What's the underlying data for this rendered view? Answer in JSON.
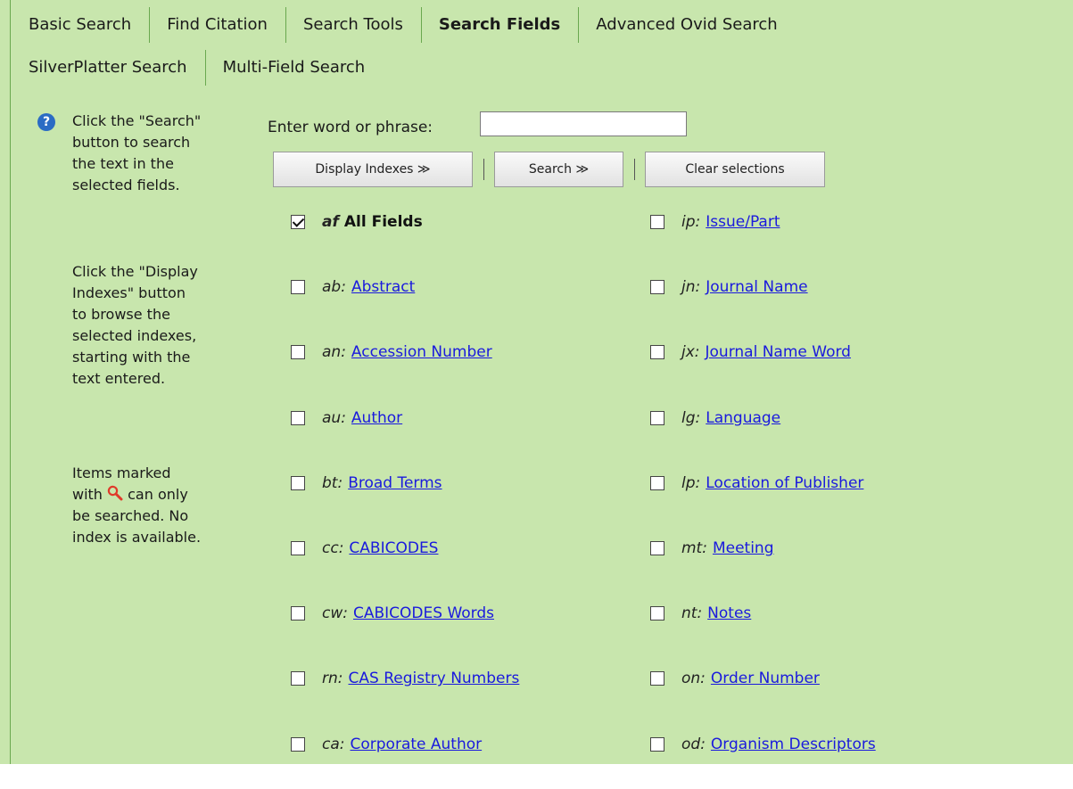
{
  "tabs_row1": [
    "Basic Search",
    "Find Citation",
    "Search Tools",
    "Search Fields",
    "Advanced Ovid Search"
  ],
  "tabs_row2": [
    "SilverPlatter Search",
    "Multi-Field Search"
  ],
  "active_tab": "Search Fields",
  "help": {
    "icon": "question-icon",
    "p1": "Click the \"Search\"\nbutton to search\nthe text in the\nselected fields.",
    "p2": "Click the \"Display\nIndexes\" button\nto browse the\nselected indexes,\nstarting with the\ntext entered.",
    "p3_before": "Items marked\nwith ",
    "p3_icon": "magnifier-icon",
    "p3_after": " can only\nbe searched. No\nindex is available."
  },
  "search": {
    "label": "Enter word or phrase:",
    "value": "",
    "display_indexes": "Display Indexes ≫",
    "search": "Search ≫",
    "clear": "Clear selections"
  },
  "fields_left": [
    {
      "code": "af",
      "name": "All Fields",
      "checked": true,
      "link": false
    },
    {
      "code": "ab:",
      "name": "Abstract",
      "checked": false,
      "link": true
    },
    {
      "code": "an:",
      "name": "Accession Number",
      "checked": false,
      "link": true
    },
    {
      "code": "au:",
      "name": "Author",
      "checked": false,
      "link": true
    },
    {
      "code": "bt:",
      "name": "Broad Terms",
      "checked": false,
      "link": true
    },
    {
      "code": "cc:",
      "name": "CABICODES",
      "checked": false,
      "link": true
    },
    {
      "code": "cw:",
      "name": "CABICODES Words",
      "checked": false,
      "link": true
    },
    {
      "code": "rn:",
      "name": "CAS Registry Numbers",
      "checked": false,
      "link": true
    },
    {
      "code": "ca:",
      "name": "Corporate Author",
      "checked": false,
      "link": true
    }
  ],
  "fields_right": [
    {
      "code": "ip:",
      "name": "Issue/Part",
      "checked": false,
      "link": true
    },
    {
      "code": "jn:",
      "name": "Journal Name",
      "checked": false,
      "link": true
    },
    {
      "code": "jx:",
      "name": "Journal Name Word",
      "checked": false,
      "link": true
    },
    {
      "code": "lg:",
      "name": "Language",
      "checked": false,
      "link": true
    },
    {
      "code": "lp:",
      "name": "Location of Publisher",
      "checked": false,
      "link": true
    },
    {
      "code": "mt:",
      "name": "Meeting",
      "checked": false,
      "link": true
    },
    {
      "code": "nt:",
      "name": "Notes",
      "checked": false,
      "link": true
    },
    {
      "code": "on:",
      "name": "Order Number",
      "checked": false,
      "link": true
    },
    {
      "code": "od:",
      "name": "Organism Descriptors",
      "checked": false,
      "link": true
    }
  ],
  "colors": {
    "panel": "#c8e6ad",
    "link": "#1a1add",
    "divider": "#6aa84f"
  }
}
